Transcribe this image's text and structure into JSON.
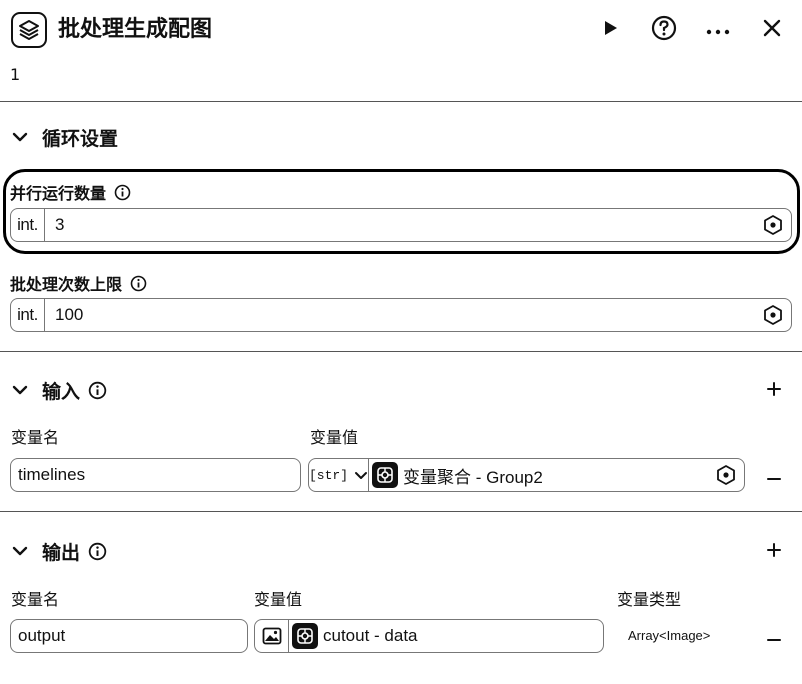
{
  "header": {
    "title": "批处理生成配图",
    "subtitle": "1",
    "icons": [
      "layers-icon",
      "play-icon",
      "help-icon",
      "more-icon",
      "close-icon"
    ]
  },
  "loop_settings": {
    "title": "循环设置",
    "concurrency": {
      "label": "并行运行数量",
      "type_tag": "int.",
      "value": "3"
    },
    "batch_limit": {
      "label": "批处理次数上限",
      "type_tag": "int.",
      "value": "100"
    }
  },
  "inputs": {
    "title": "输入",
    "col_name": "变量名",
    "col_value": "变量值",
    "rows": [
      {
        "name": "timelines",
        "type_tag": "[str]",
        "ref": "变量聚合 - Group2"
      }
    ]
  },
  "outputs": {
    "title": "输出",
    "col_name": "变量名",
    "col_value": "变量值",
    "col_type": "变量类型",
    "rows": [
      {
        "name": "output",
        "ref": "cutout - data",
        "type": "Array<Image>"
      }
    ]
  },
  "colors": {
    "text": "#111111",
    "border": "#777777",
    "highlight": "#000000"
  }
}
